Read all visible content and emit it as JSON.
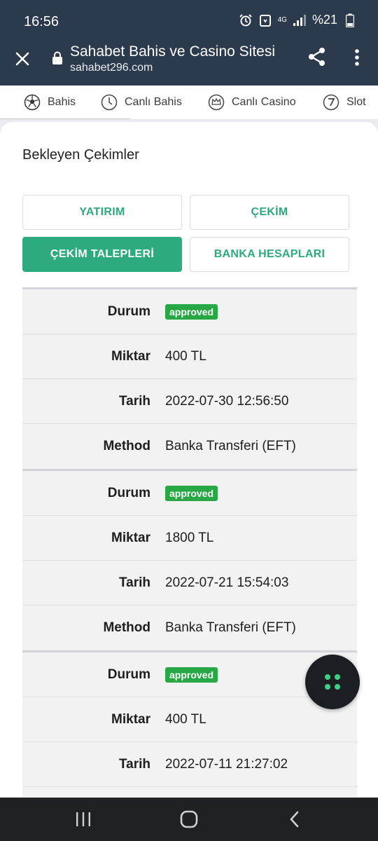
{
  "status_bar": {
    "time": "16:56",
    "network": "4G",
    "battery": "%21"
  },
  "browser": {
    "title": "Sahabet Bahis ve Casino Sitesi",
    "host": "sahabet296.com"
  },
  "nav": {
    "items": [
      {
        "label": "Bahis",
        "icon": "soccer-ball-icon"
      },
      {
        "label": "Canlı Bahis",
        "icon": "clock-icon"
      },
      {
        "label": "Canlı Casino",
        "icon": "crown-icon"
      },
      {
        "label": "Slot",
        "icon": "seven-icon"
      }
    ]
  },
  "page": {
    "title": "Bekleyen Çekimler",
    "tabs": {
      "deposit": "YATIRIM",
      "withdraw": "ÇEKİM",
      "requests": "ÇEKİM TALEPLERİ",
      "bank_accounts": "BANKA HESAPLARI"
    },
    "labels": {
      "status": "Durum",
      "amount": "Miktar",
      "date": "Tarih",
      "method": "Method"
    },
    "records": [
      {
        "status": "approved",
        "amount": "400 TL",
        "date": "2022-07-30 12:56:50",
        "method": "Banka Transferi (EFT)"
      },
      {
        "status": "approved",
        "amount": "1800 TL",
        "date": "2022-07-21 15:54:03",
        "method": "Banka Transferi (EFT)"
      },
      {
        "status": "approved",
        "amount": "400 TL",
        "date": "2022-07-11 21:27:02"
      }
    ]
  },
  "colors": {
    "accent": "#2daa7e",
    "badge": "#27a844",
    "topbar": "#2b3a4d"
  }
}
